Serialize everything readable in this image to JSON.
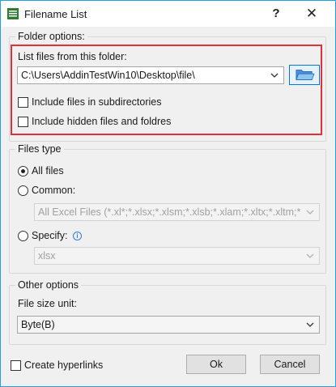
{
  "window": {
    "title": "Filename List",
    "help_label": "?",
    "close_label": "✕"
  },
  "folder_options": {
    "group_label": "Folder options:",
    "list_label": "List files from this folder:",
    "folder_path": "C:\\Users\\AddinTestWin10\\Desktop\\file\\",
    "include_subdirectories": {
      "label": "Include files in subdirectories",
      "checked": false
    },
    "include_hidden": {
      "label": "Include hidden files and foldres",
      "checked": false
    }
  },
  "files_type": {
    "group_label": "Files type",
    "all_files": {
      "label": "All files",
      "selected": true
    },
    "common": {
      "label": "Common:",
      "selected": false,
      "value": "All Excel Files (*.xl*;*.xlsx;*.xlsm;*.xlsb;*.xlam;*.xltx;*.xltm;*"
    },
    "specify": {
      "label": "Specify:",
      "selected": false,
      "value": "xlsx"
    }
  },
  "other_options": {
    "group_label": "Other options",
    "size_unit_label": "File size unit:",
    "size_unit_value": "Byte(B)"
  },
  "footer": {
    "create_hyperlinks": {
      "label": "Create hyperlinks",
      "checked": false
    },
    "ok_label": "Ok",
    "cancel_label": "Cancel"
  },
  "colors": {
    "highlight_border": "#e0303a",
    "window_border": "#1ea0e8",
    "accent": "#0078d7"
  }
}
